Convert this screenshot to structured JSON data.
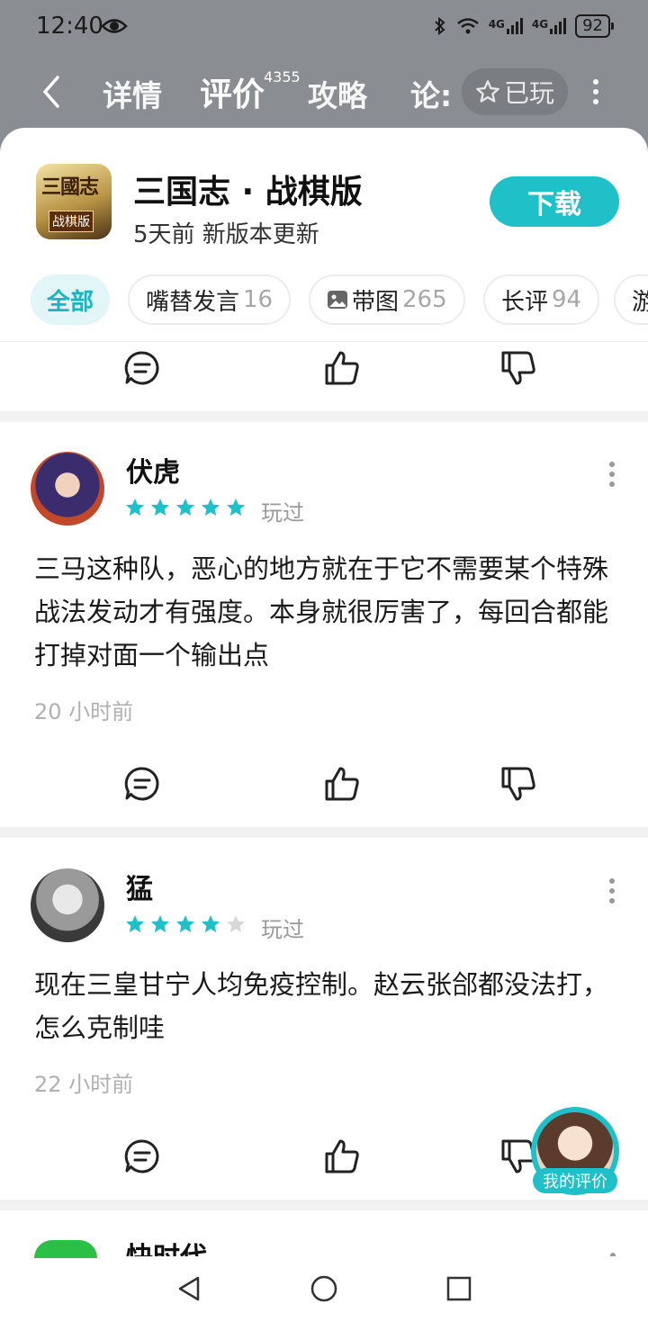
{
  "status_bar": {
    "time": "12:40",
    "battery": "92",
    "network_1": "4G",
    "network_2": "4G"
  },
  "nav": {
    "tabs": [
      {
        "label": "详情"
      },
      {
        "label": "评价"
      },
      {
        "label": "攻略"
      },
      {
        "label": "论:"
      }
    ],
    "review_count": "4355",
    "played_label": "已玩"
  },
  "app": {
    "title": "三国志 · 战棋版",
    "subtitle": "5天前 新版本更新",
    "icon_text": "三國志",
    "icon_sub": "战棋版",
    "download_label": "下载"
  },
  "filters": [
    {
      "label": "全部",
      "count": ""
    },
    {
      "label": "嘴替发言",
      "count": "16"
    },
    {
      "label": "带图",
      "count": "265"
    },
    {
      "label": "长评",
      "count": "94"
    },
    {
      "label": "游",
      "count": ""
    }
  ],
  "reviews": [
    {
      "name": "伏虎",
      "stars": 5,
      "status": "玩过",
      "content": "三马这种队，恶心的地方就在于它不需要某个特殊战法发动才有强度。本身就很厉害了，每回合都能打掉对面一个输出点",
      "time": "20 小时前"
    },
    {
      "name": "猛",
      "stars": 4,
      "status": "玩过",
      "content": "现在三皇甘宁人均免疫控制。赵云张郃都没法打，怎么克制哇",
      "time": "22 小时前"
    }
  ],
  "partial_review": {
    "name": "快时代"
  },
  "fab": {
    "label": "我的评价"
  },
  "colors": {
    "accent": "#1fc0c8",
    "star": "#1fc0c8",
    "star_empty": "#d8d8d8"
  }
}
